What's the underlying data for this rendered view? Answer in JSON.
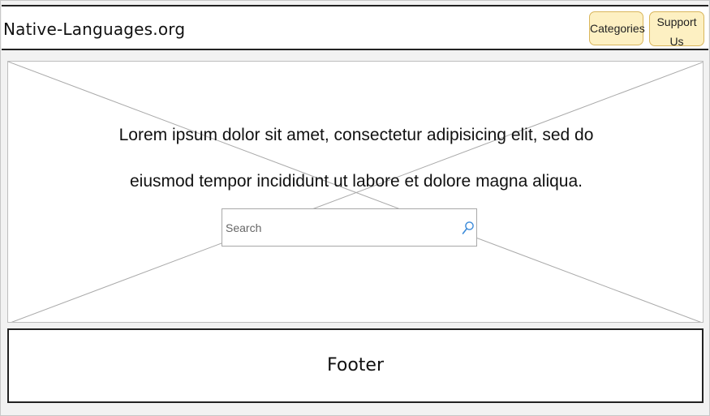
{
  "header": {
    "site_title": "Native-Languages.org",
    "nav": {
      "categories_label": "Categories",
      "support_label_line1": "Support",
      "support_label_line2": "Us"
    }
  },
  "hero": {
    "text_line1": "Lorem ipsum dolor sit amet, consectetur adipisicing elit, sed do",
    "text_line2": "eiusmod tempor incididunt ut labore et dolore magna aliqua.",
    "search": {
      "placeholder": "Search",
      "value": ""
    }
  },
  "footer": {
    "label": "Footer"
  },
  "icons": {
    "search": "search-icon"
  },
  "colors": {
    "button_fill": "#fdf0c2",
    "button_border": "#d9b65c",
    "search_icon": "#3b8ad9"
  }
}
